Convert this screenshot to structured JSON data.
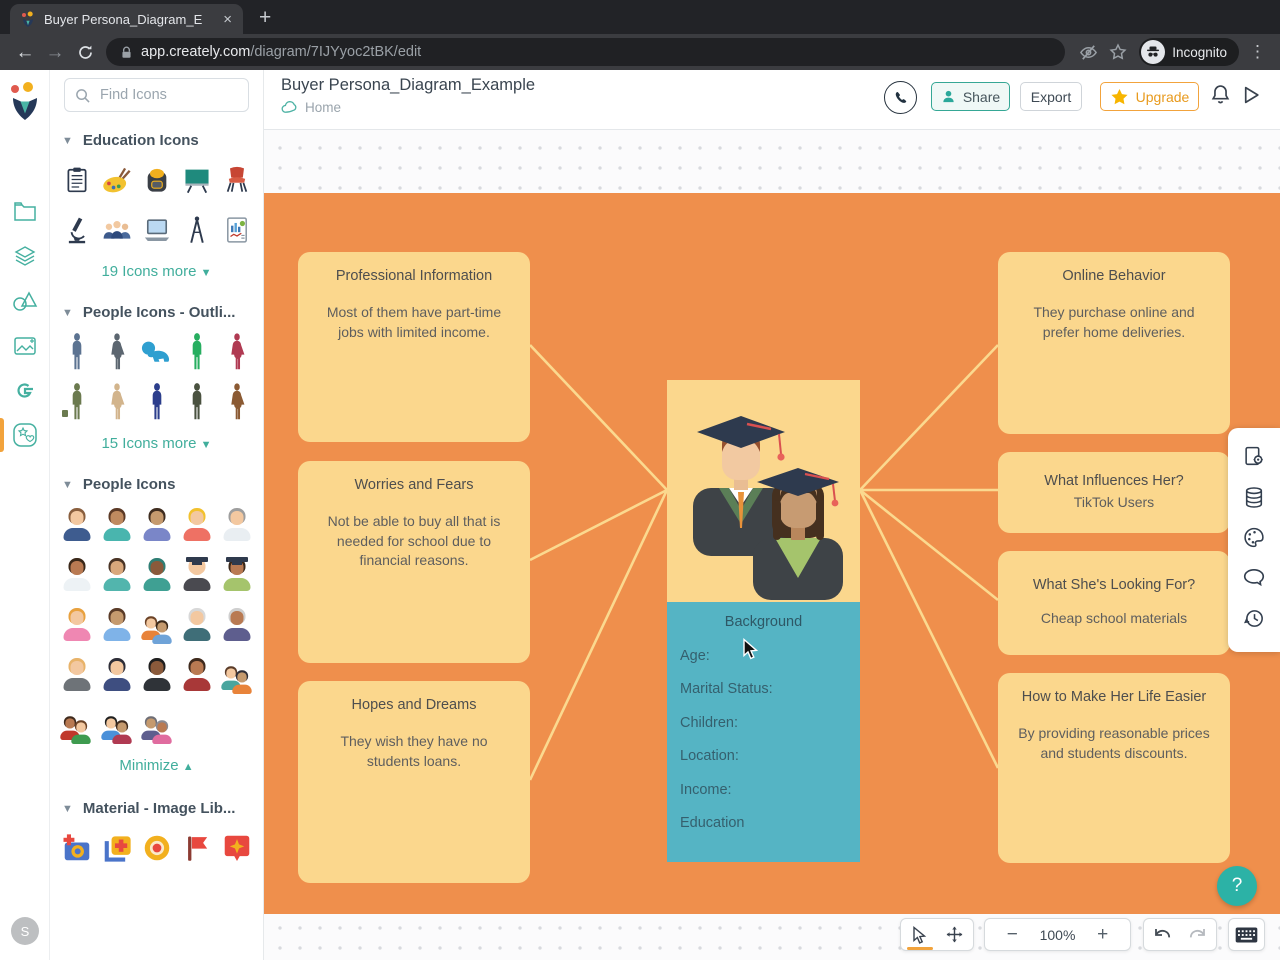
{
  "colors": {
    "accent_teal": "#41AE9C",
    "accent_orange": "#F2A33C",
    "diagram_bg": "#EF8F4C",
    "card_bg": "#FBD78D",
    "background_box": "#55B4C4"
  },
  "browser": {
    "tab_title": "Buyer Persona_Diagram_E",
    "url_domain": "app.creately.com",
    "url_path": "/diagram/7IJYyoc2tBK/edit",
    "incognito_label": "Incognito"
  },
  "header": {
    "title": "Buyer Persona_Diagram_Example",
    "breadcrumb_home": "Home",
    "share_label": "Share",
    "export_label": "Export",
    "upgrade_label": "Upgrade"
  },
  "sidebar": {
    "search_placeholder": "Find Icons",
    "sections": {
      "education": {
        "title": "Education Icons",
        "more_label": "19 Icons more",
        "icons": [
          "clipboard-icon",
          "paint-palette-icon",
          "backpack-icon",
          "chalkboard-icon",
          "school-chair-icon",
          "microscope-icon",
          "students-icon",
          "laptop-icon",
          "drawing-compass-icon",
          "report-icon"
        ]
      },
      "people_outline": {
        "title": "People Icons - Outli...",
        "more_label": "15 Icons more",
        "icons": [
          "standing-man",
          "standing-woman",
          "crawling-baby",
          "walking-man",
          "standing-woman-red",
          "man-with-briefcase",
          "standing-woman-tan",
          "standing-man-navy",
          "standing-man-olive",
          "standing-woman-brown"
        ]
      },
      "people": {
        "title": "People Icons",
        "minimize_label": "Minimize",
        "icons": [
          "man-suit",
          "woman-teal",
          "man-purple",
          "woman-blonde",
          "male-doctor",
          "female-doctor",
          "nurse",
          "surgeon",
          "male-graduate",
          "female-graduate",
          "baby-girl",
          "baby-boy",
          "family",
          "old-man",
          "old-woman",
          "businessman",
          "businesswoman",
          "businessman-dark",
          "woman-red",
          "people-group",
          "family-group",
          "couple",
          "couple-2"
        ]
      },
      "material": {
        "title": "Material - Image Lib...",
        "icons": [
          "add-photo-icon",
          "add-image-icon",
          "target-icon",
          "flag-icon",
          "sparkle-pin-icon"
        ]
      }
    }
  },
  "diagram": {
    "cards": {
      "professional": {
        "title": "Professional Information",
        "body": "Most of them have part-time jobs with limited income."
      },
      "worries": {
        "title": "Worries and Fears",
        "body": "Not be able to buy all that is needed for school due to financial reasons."
      },
      "hopes": {
        "title": "Hopes and Dreams",
        "body": "They wish they have no students loans."
      },
      "online": {
        "title": "Online Behavior",
        "body": "They purchase online and prefer home deliveries."
      },
      "influences": {
        "title": "What Influences Her?",
        "body": "TikTok  Users"
      },
      "looking": {
        "title": "What She's Looking For?",
        "body": "Cheap school materials"
      },
      "easier": {
        "title": "How to Make Her Life Easier",
        "body": "By providing reasonable prices and students discounts."
      }
    },
    "background_box": {
      "title": "Background",
      "items": [
        "Age:",
        "Marital Status:",
        "Children:",
        "Location:",
        "Income:",
        "Education"
      ]
    }
  },
  "footer_toolbar": {
    "zoom_level": "100%"
  },
  "help_label": "?",
  "user_avatar": "S"
}
